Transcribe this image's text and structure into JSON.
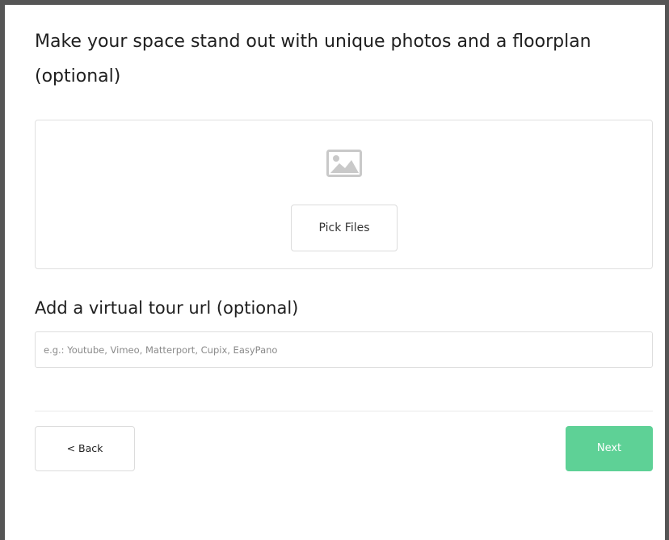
{
  "heading": "Make your space stand out with unique photos and a floorplan (optional)",
  "upload": {
    "icon": "image-placeholder-icon",
    "pick_files_label": "Pick Files"
  },
  "virtual_tour": {
    "heading": "Add a virtual tour url (optional)",
    "value": "",
    "placeholder": "e.g.: Youtube, Vimeo, Matterport, Cupix, EasyPano"
  },
  "navigation": {
    "back_label": "< Back",
    "next_label": "Next"
  },
  "colors": {
    "next_button": "#5ed196",
    "icon": "#c9c9c9",
    "window_border": "#555555"
  }
}
